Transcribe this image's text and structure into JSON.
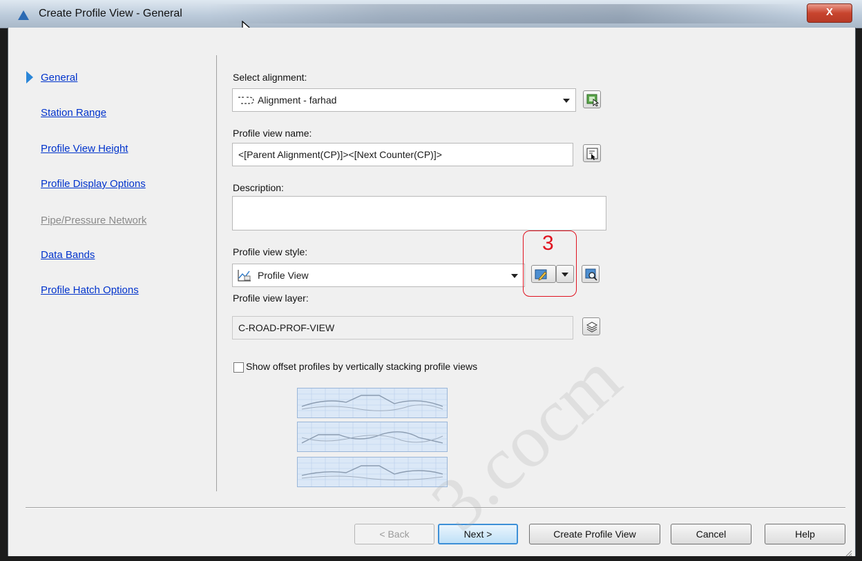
{
  "window": {
    "title": "Create Profile View - General",
    "close_label": "X"
  },
  "nav": {
    "items": [
      {
        "label": "General",
        "active": true,
        "enabled": true
      },
      {
        "label": "Station Range",
        "active": false,
        "enabled": true
      },
      {
        "label": "Profile View Height",
        "active": false,
        "enabled": true
      },
      {
        "label": "Profile Display Options",
        "active": false,
        "enabled": true
      },
      {
        "label": "Pipe/Pressure Network",
        "active": false,
        "enabled": false
      },
      {
        "label": "Data Bands",
        "active": false,
        "enabled": true
      },
      {
        "label": "Profile Hatch Options",
        "active": false,
        "enabled": true
      }
    ]
  },
  "form": {
    "alignment": {
      "label": "Select alignment:",
      "value": "Alignment - farhad"
    },
    "view_name": {
      "label": "Profile view name:",
      "value": "<[Parent Alignment(CP)]><[Next Counter(CP)]>"
    },
    "description": {
      "label": "Description:",
      "value": ""
    },
    "style": {
      "label": "Profile view style:",
      "value": "Profile View"
    },
    "layer": {
      "label": "Profile view layer:",
      "value": "C-ROAD-PROF-VIEW"
    },
    "stack_checkbox": {
      "label": "Show offset profiles by vertically stacking profile views",
      "checked": false
    }
  },
  "annotation": {
    "number": "3",
    "color": "#e0121f"
  },
  "buttons": {
    "back": "< Back",
    "next": "Next >",
    "create": "Create Profile View",
    "cancel": "Cancel",
    "help": "Help"
  },
  "watermark": "3.cocm",
  "icons": {
    "app": "civil3d-triangle-icon",
    "pick_alignment": "pick-from-drawing-icon",
    "edit_name": "edit-name-template-icon",
    "edit_style": "edit-style-icon",
    "preview_style": "preview-style-icon",
    "layer": "layer-icon"
  }
}
